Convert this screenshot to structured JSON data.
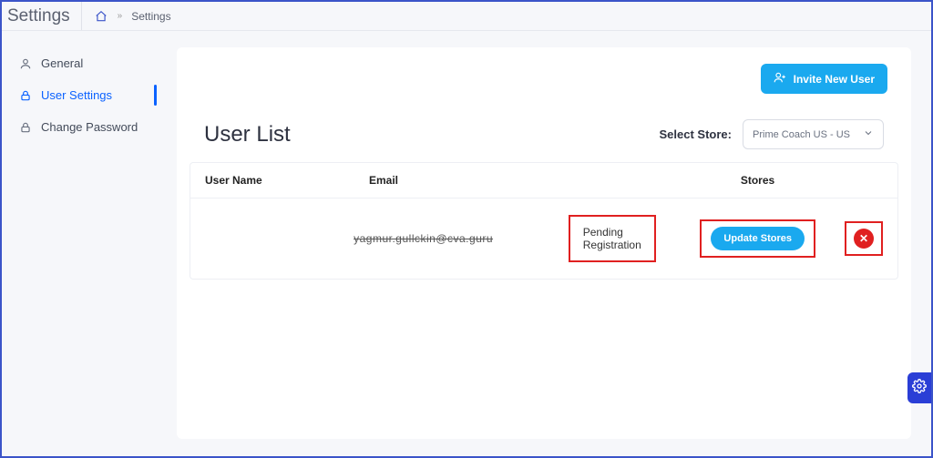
{
  "topbar": {
    "title": "Settings",
    "breadcrumb_current": "Settings"
  },
  "sidebar": {
    "items": [
      {
        "label": "General",
        "icon": "user-icon",
        "active": false
      },
      {
        "label": "User Settings",
        "icon": "lock-icon",
        "active": true
      },
      {
        "label": "Change Password",
        "icon": "lock-icon",
        "active": false
      }
    ]
  },
  "actions": {
    "invite_label": "Invite New User"
  },
  "list": {
    "title": "User List",
    "store_label": "Select Store:",
    "store_selected": "Prime Coach US - US",
    "columns": {
      "user_name": "User Name",
      "email": "Email",
      "stores": "Stores"
    },
    "rows": [
      {
        "user_name": "",
        "email": "yagmur.gullckin@cva.guru",
        "status": "Pending Registration",
        "update_label": "Update Stores"
      }
    ]
  }
}
